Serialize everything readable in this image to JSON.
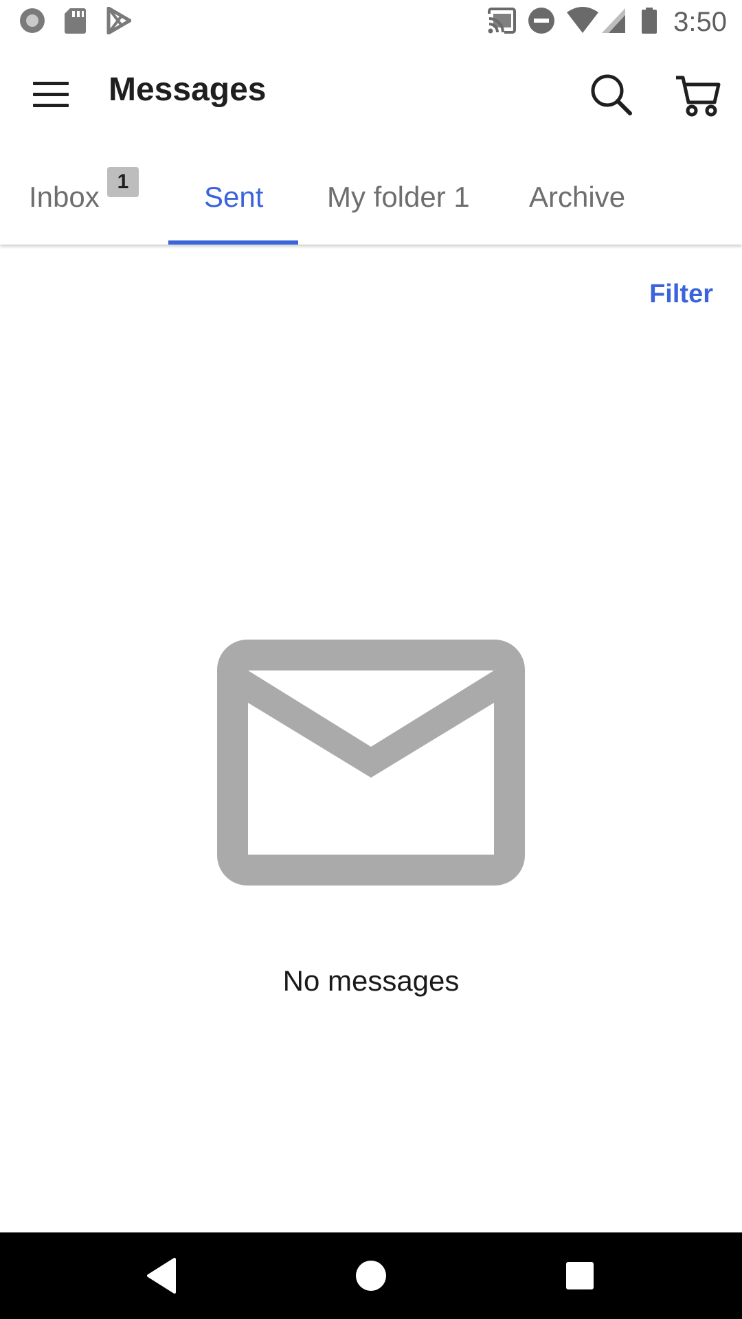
{
  "status_bar": {
    "time": "3:50",
    "left_icons": [
      "record-icon",
      "sd-card-icon",
      "play-store-icon"
    ],
    "right_icons": [
      "cast-icon",
      "do-not-disturb-icon",
      "wifi-icon",
      "cell-signal-icon",
      "battery-icon"
    ]
  },
  "app_bar": {
    "title": "Messages",
    "icons": [
      "menu-icon",
      "search-icon",
      "cart-icon"
    ]
  },
  "tabs": [
    {
      "label": "Inbox",
      "badge": "1",
      "active": false
    },
    {
      "label": "Sent",
      "active": true
    },
    {
      "label": "My folder 1",
      "active": false
    },
    {
      "label": "Archive",
      "active": false
    }
  ],
  "filter_label": "Filter",
  "empty_state": {
    "icon": "envelope-icon",
    "text": "No messages"
  },
  "colors": {
    "accent": "#3b64db",
    "icon_gray": "#aaaaaa",
    "tab_inactive": "#6e6e6e",
    "badge_bg": "#bdbdbd"
  },
  "nav_bar": {
    "icons": [
      "back-icon",
      "home-icon",
      "recents-icon"
    ]
  }
}
